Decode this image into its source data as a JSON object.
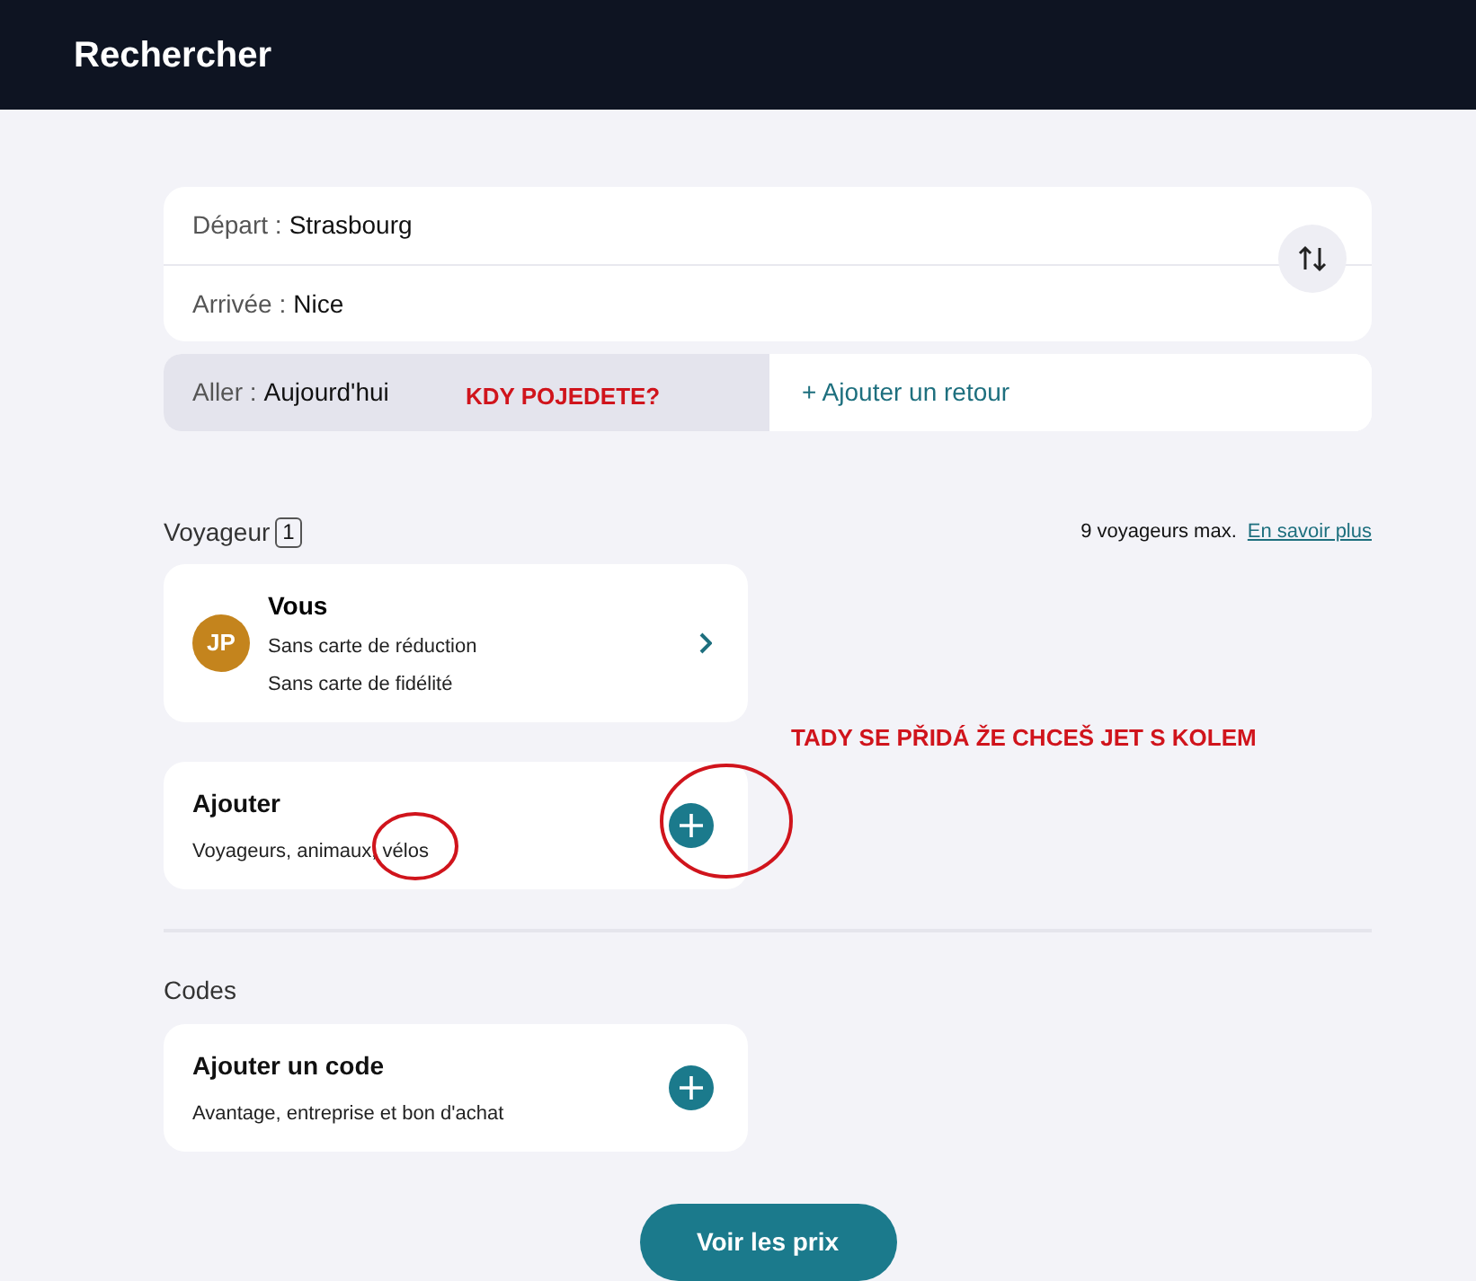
{
  "header": {
    "title": "Rechercher"
  },
  "route": {
    "departure": {
      "label": "Départ :",
      "value": "Strasbourg"
    },
    "arrival": {
      "label": "Arrivée :",
      "value": "Nice"
    }
  },
  "dates": {
    "outbound": {
      "label": "Aller :",
      "value": "Aujourd'hui"
    },
    "return_link": {
      "icon": "+",
      "label": "Ajouter un retour"
    }
  },
  "travelers": {
    "heading": "Voyageur",
    "count": "1",
    "max_note": "9 voyageurs max.",
    "learn_more": "En savoir plus",
    "passenger": {
      "initials": "JP",
      "name": "Vous",
      "lines": [
        "Sans carte de réduction",
        "Sans carte de fidélité"
      ]
    },
    "add": {
      "title": "Ajouter",
      "subtitle": "Voyageurs, animaux, vélos"
    }
  },
  "codes": {
    "heading": "Codes",
    "add": {
      "title": "Ajouter un code",
      "subtitle": "Avantage, entreprise et bon d'achat"
    }
  },
  "submit": "Voir les prix",
  "annotations": [
    {
      "kind": "note",
      "text": "KDY POJEDETE?"
    },
    {
      "kind": "note",
      "text": "TADY SE PŘIDÁ ŽE CHCEŠ JET S KOLEM"
    }
  ]
}
